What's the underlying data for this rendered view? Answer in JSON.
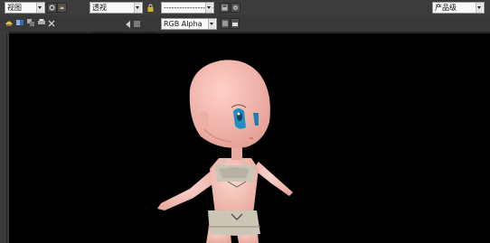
{
  "toolbar_top": {
    "view_select": "视图",
    "projection_select": "透视",
    "line_select": "------------------------",
    "product_select": "产品级"
  },
  "toolbar_bottom": {
    "color_channels": [
      {
        "name": "red",
        "color": "#d41a1a"
      },
      {
        "name": "green",
        "color": "#1fa83a"
      },
      {
        "name": "blue",
        "color": "#2038c8"
      }
    ],
    "channel_select": "RGB Alpha"
  },
  "viewport": {
    "background": "#000000"
  }
}
